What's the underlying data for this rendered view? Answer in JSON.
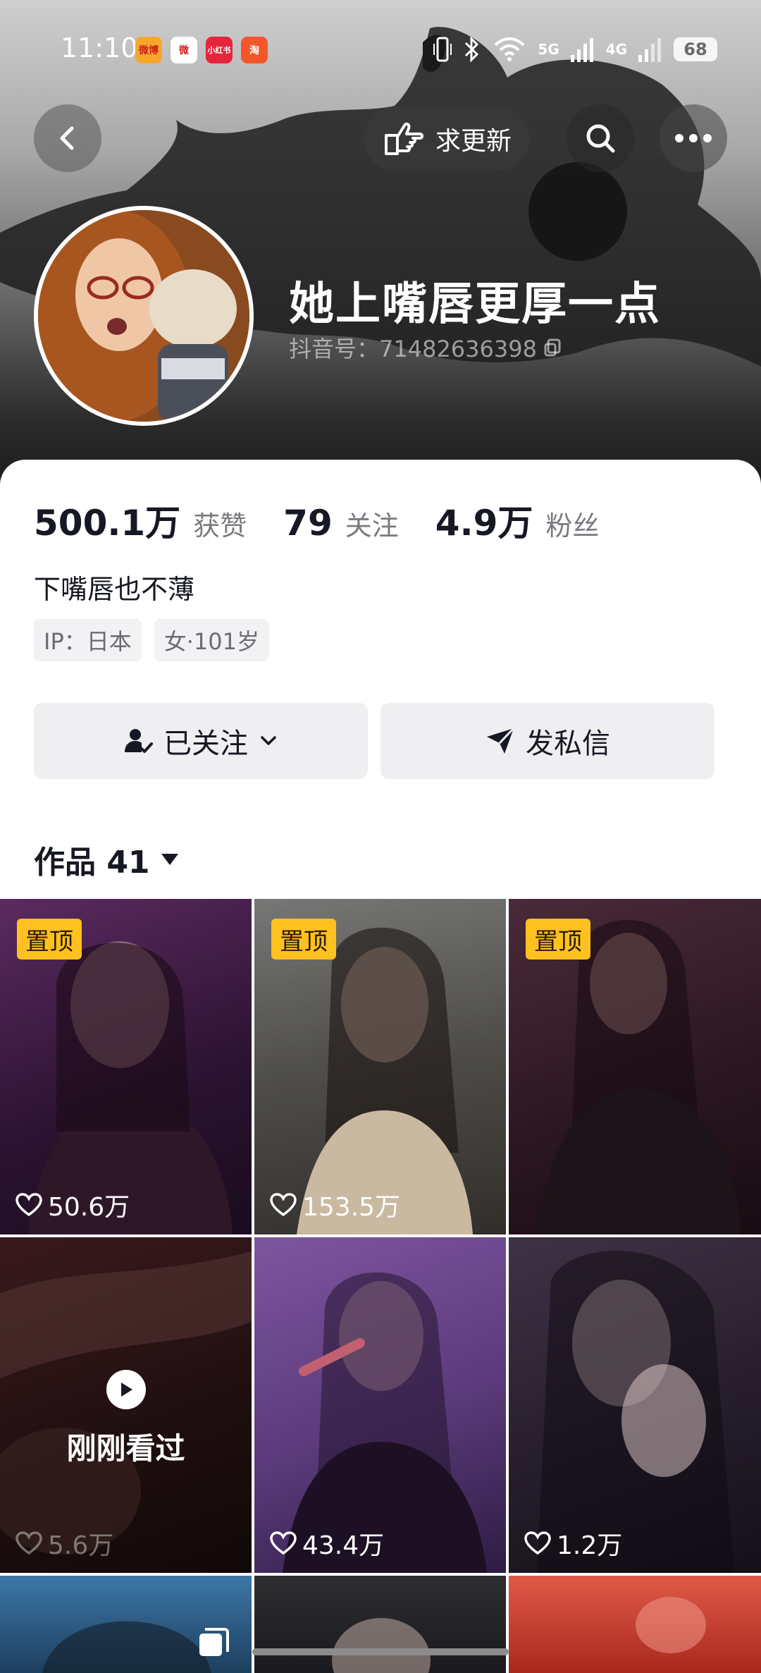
{
  "status_bar": {
    "time": "11:10",
    "apps": [
      {
        "icon": "weibo-icon",
        "label": "微博",
        "bg": "#f4a72a"
      },
      {
        "icon": "weibo-alt-icon",
        "label": "微",
        "bg": "#ffffff"
      },
      {
        "icon": "xiaohongshu-icon",
        "label": "小红书",
        "bg": "#e4253b"
      },
      {
        "icon": "taobao-icon",
        "label": "淘",
        "bg": "#f3562a"
      }
    ],
    "network_5g": "5G",
    "network_4g": "4G",
    "battery": "68"
  },
  "header": {
    "request_update": "求更新"
  },
  "profile": {
    "name": "她上嘴唇更厚一点",
    "douyin_id": "抖音号：71482636398",
    "stats": [
      {
        "value": "500.1万",
        "label": "获赞"
      },
      {
        "value": "79",
        "label": "关注"
      },
      {
        "value": "4.9万",
        "label": "粉丝"
      }
    ],
    "bio": "下嘴唇也不薄",
    "tags": [
      "IP：日本",
      "女·101岁"
    ]
  },
  "actions": {
    "following": "已关注",
    "message": "发私信"
  },
  "works_tab": {
    "label": "作品 41"
  },
  "videos": [
    {
      "pinned": "置顶",
      "likes": "50.6万",
      "bg": "#3a1c3e"
    },
    {
      "pinned": "置顶",
      "likes": "153.5万",
      "bg": "#5d5a57"
    },
    {
      "pinned": "置顶",
      "likes": "",
      "bg": "#3b1e2a"
    },
    {
      "watched": "刚刚看过",
      "likes": "5.6万",
      "bg": "#1e0f10"
    },
    {
      "likes": "43.4万",
      "bg": "#5e3a7a"
    },
    {
      "likes": "1.2万",
      "bg": "#2e2535"
    },
    {
      "bg": "#2c5a86"
    },
    {
      "bg": "#2a2a2e"
    },
    {
      "bg": "#d24a3c"
    }
  ]
}
